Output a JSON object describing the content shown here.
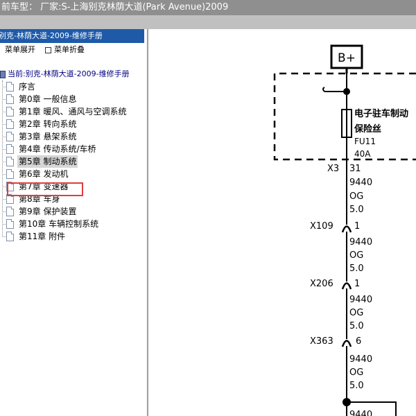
{
  "title_bar": {
    "text": "前车型： 厂家:S-上海别克林荫大道(Park Avenue)2009"
  },
  "manual": {
    "header": "别克-林荫大道-2009-维修手册"
  },
  "toolbar": {
    "expand_label": "菜单展开",
    "collapse_label": "菜单折叠"
  },
  "current": {
    "label": "当前:别克-林荫大道-2009-维修手册"
  },
  "tree": {
    "items": [
      {
        "label": "序言"
      },
      {
        "label": "第0章 一般信息"
      },
      {
        "label": "第1章 暖风、通风与空调系统"
      },
      {
        "label": "第2章 转向系统"
      },
      {
        "label": "第3章 悬架系统"
      },
      {
        "label": "第4章 传动系统/车桥"
      },
      {
        "label": "第5章 制动系统",
        "selected": true
      },
      {
        "label": "第6章 发动机"
      },
      {
        "label": "第7章 变速器"
      },
      {
        "label": "第8章 车身"
      },
      {
        "label": "第9章 保护装置"
      },
      {
        "label": "第10章 车辆控制系统"
      },
      {
        "label": "第11章 附件"
      }
    ]
  },
  "diagram": {
    "power_label": "B+",
    "fuse": {
      "name_line1": "电子驻车制动",
      "name_line2": "保险丝",
      "id": "FU11",
      "rating": "40A"
    },
    "connectors": [
      {
        "id": "X3",
        "pin": "31"
      },
      {
        "id": "X109",
        "pin": "1"
      },
      {
        "id": "X206",
        "pin": "1"
      },
      {
        "id": "X363",
        "pin": "6"
      }
    ],
    "wires": [
      {
        "circuit": "9440",
        "color": "OG",
        "size": "5.0"
      },
      {
        "circuit": "9440",
        "color": "OG",
        "size": "5.0"
      },
      {
        "circuit": "9440",
        "color": "OG",
        "size": "5.0"
      },
      {
        "circuit": "9440",
        "color": "OG",
        "size": "5.0"
      }
    ],
    "bottom_label": "9440"
  }
}
